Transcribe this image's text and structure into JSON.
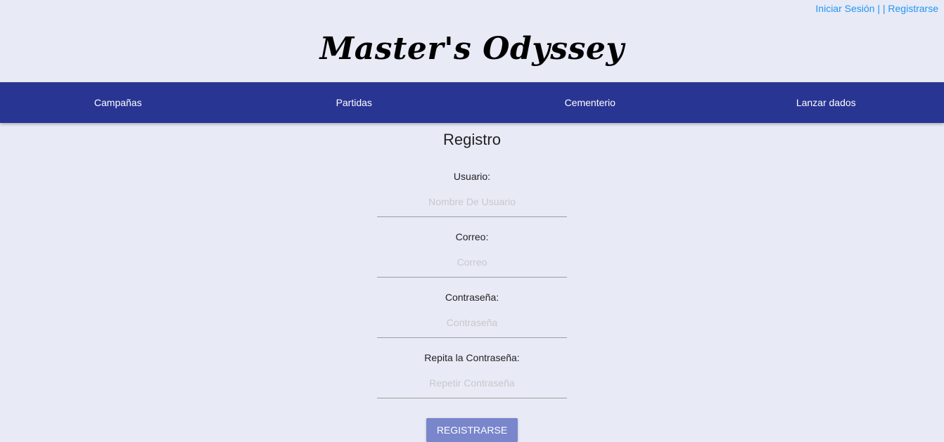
{
  "auth_links": {
    "login": "Iniciar Sesión",
    "separator": "| |",
    "register": "Registrarse"
  },
  "brand": {
    "title": "Master's Odyssey"
  },
  "nav": {
    "items": [
      {
        "label": "Campañas"
      },
      {
        "label": "Partidas"
      },
      {
        "label": "Cementerio"
      },
      {
        "label": "Lanzar dados"
      }
    ]
  },
  "form": {
    "title": "Registro",
    "fields": [
      {
        "label": "Usuario:",
        "placeholder": "Nombre De Usuario",
        "value": ""
      },
      {
        "label": "Correo:",
        "placeholder": "Correo",
        "value": ""
      },
      {
        "label": "Contraseña:",
        "placeholder": "Contraseña",
        "value": ""
      },
      {
        "label": "Repita la Contraseña:",
        "placeholder": "Repetir Contraseña",
        "value": ""
      }
    ],
    "submit_label": "REGISTRARSE"
  },
  "colors": {
    "background": "#e8eaf6",
    "navbar": "#283593",
    "link": "#2196f3",
    "button": "#7986cb"
  }
}
